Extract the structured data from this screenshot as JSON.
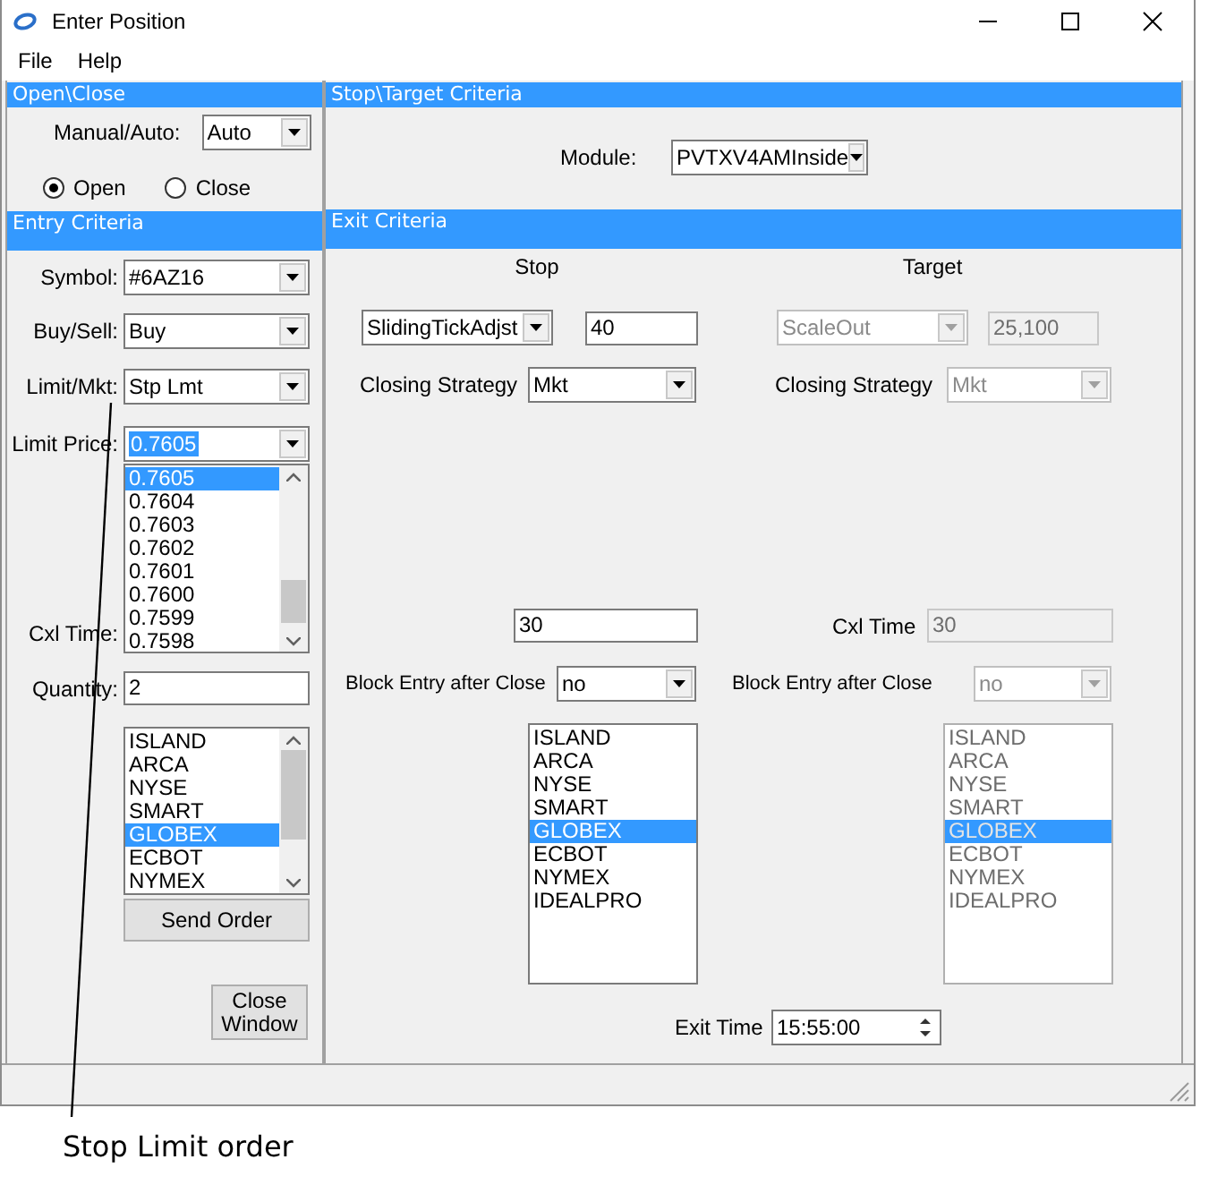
{
  "window": {
    "title": "Enter Position"
  },
  "menu": [
    "File",
    "Help"
  ],
  "open_close": {
    "header": "Open\\Close",
    "manual_auto": {
      "label": "Manual/Auto:",
      "value": "Auto"
    },
    "radios": [
      {
        "label": "Open",
        "selected": true
      },
      {
        "label": "Close",
        "selected": false
      }
    ]
  },
  "entry_criteria": {
    "header": "Entry Criteria",
    "symbol": {
      "label": "Symbol:",
      "value": "#6AZ16"
    },
    "buy_sell": {
      "label": "Buy/Sell:",
      "value": "Buy"
    },
    "limit_mkt": {
      "label": "Limit/Mkt:",
      "value": "Stp Lmt"
    },
    "limit_price": {
      "label": "Limit Price:",
      "value": "0.7605",
      "focused": true
    },
    "price_list": [
      {
        "text": "0.7605",
        "selected": true
      },
      {
        "text": "0.7604",
        "selected": false
      },
      {
        "text": "0.7603",
        "selected": false
      },
      {
        "text": "0.7602",
        "selected": false
      },
      {
        "text": "0.7601",
        "selected": false
      },
      {
        "text": "0.7600",
        "selected": false
      },
      {
        "text": "0.7599",
        "selected": false
      },
      {
        "text": "0.7598",
        "selected": false
      }
    ],
    "cxl_time": {
      "label": "Cxl Time:"
    },
    "quantity": {
      "label": "Quantity:",
      "value": "2"
    },
    "exchanges": [
      {
        "text": "ISLAND",
        "selected": false
      },
      {
        "text": "ARCA",
        "selected": false
      },
      {
        "text": "NYSE",
        "selected": false
      },
      {
        "text": "SMART",
        "selected": false
      },
      {
        "text": "GLOBEX",
        "selected": true
      },
      {
        "text": "ECBOT",
        "selected": false
      },
      {
        "text": "NYMEX",
        "selected": false
      }
    ],
    "send_order": "Send Order",
    "close_window": "Close Window"
  },
  "stop_target": {
    "header": "Stop\\Target Criteria",
    "module": {
      "label": "Module:",
      "value": "PVTXV4AMInside"
    }
  },
  "exit_criteria": {
    "header": "Exit Criteria",
    "columns": [
      {
        "heading": "Stop",
        "disabled": false,
        "strategy": "SlidingTickAdjst",
        "amount": "40",
        "closing_strategy": {
          "label": "Closing Strategy",
          "value": "Mkt"
        },
        "cxl_time": {
          "value": "30"
        },
        "block_entry": {
          "label": "Block Entry after Close",
          "value": "no"
        },
        "exchanges": [
          {
            "text": "ISLAND",
            "selected": false
          },
          {
            "text": "ARCA",
            "selected": false
          },
          {
            "text": "NYSE",
            "selected": false
          },
          {
            "text": "SMART",
            "selected": false
          },
          {
            "text": "GLOBEX",
            "selected": true
          },
          {
            "text": "ECBOT",
            "selected": false
          },
          {
            "text": "NYMEX",
            "selected": false
          },
          {
            "text": "IDEALPRO",
            "selected": false
          }
        ]
      },
      {
        "heading": "Target",
        "disabled": true,
        "strategy": "ScaleOut",
        "amount": "25,100",
        "closing_strategy": {
          "label": "Closing Strategy",
          "value": "Mkt"
        },
        "cxl_time": {
          "label": "Cxl Time",
          "value": "30"
        },
        "block_entry": {
          "label": "Block Entry after Close",
          "value": "no"
        },
        "exchanges": [
          {
            "text": "ISLAND",
            "selected": false
          },
          {
            "text": "ARCA",
            "selected": false
          },
          {
            "text": "NYSE",
            "selected": false
          },
          {
            "text": "SMART",
            "selected": false
          },
          {
            "text": "GLOBEX",
            "selected": true
          },
          {
            "text": "ECBOT",
            "selected": false
          },
          {
            "text": "NYMEX",
            "selected": false
          },
          {
            "text": "IDEALPRO",
            "selected": false
          }
        ]
      }
    ],
    "exit_time": {
      "label": "Exit Time",
      "value": "15:55:00"
    }
  },
  "annotation": {
    "text": "Stop Limit order"
  }
}
